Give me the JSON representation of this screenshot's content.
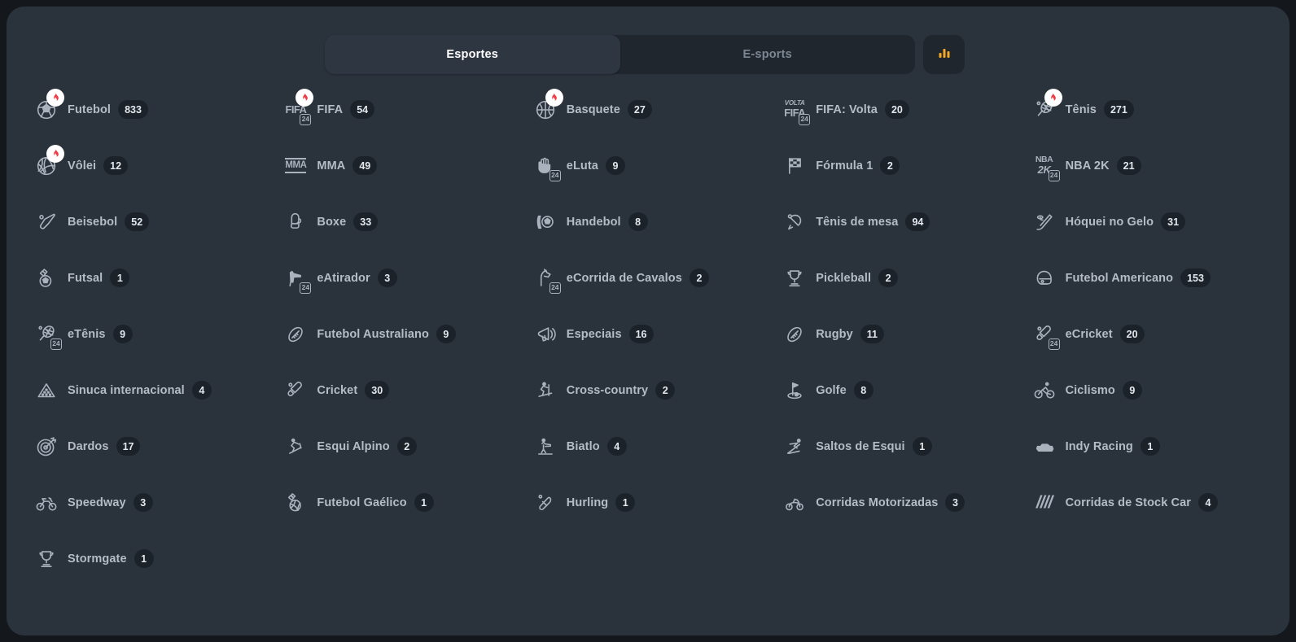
{
  "colors": {
    "page_background": "#14181d",
    "panel_background": "#2a323c",
    "tab_track": "#1f262e",
    "tab_active": "#2e3641",
    "accent_orange": "#f5a623",
    "hot_flame": "#ef3b45",
    "count_pill": "#1b222a",
    "label_text": "#b4bcc6"
  },
  "header": {
    "tabs": [
      {
        "label": "Esportes",
        "active": true,
        "name": "tab-esportes"
      },
      {
        "label": "E-sports",
        "active": false,
        "name": "tab-esports"
      }
    ],
    "chart_button": {
      "icon": "bar-chart-icon",
      "label": ""
    }
  },
  "grid": {
    "columns": 5,
    "items": [
      {
        "label": "Futebol",
        "count": "833",
        "icon": "soccer-ball-icon",
        "hot": true
      },
      {
        "label": "FIFA",
        "count": "54",
        "icon": "fifa-24-icon",
        "hot": true
      },
      {
        "label": "Basquete",
        "count": "27",
        "icon": "basketball-icon",
        "hot": true
      },
      {
        "label": "FIFA: Volta",
        "count": "20",
        "icon": "fifa-volta-24-icon",
        "hot": false
      },
      {
        "label": "Tênis",
        "count": "271",
        "icon": "tennis-racket-icon",
        "hot": true
      },
      {
        "label": "Vôlei",
        "count": "12",
        "icon": "volleyball-icon",
        "hot": true
      },
      {
        "label": "MMA",
        "count": "49",
        "icon": "mma-icon",
        "hot": false
      },
      {
        "label": "eLuta",
        "count": "9",
        "icon": "efighting-24-icon",
        "hot": false
      },
      {
        "label": "Fórmula 1",
        "count": "2",
        "icon": "checkered-flag-icon",
        "hot": false
      },
      {
        "label": "NBA 2K",
        "count": "21",
        "icon": "nba2k-24-icon",
        "hot": false
      },
      {
        "label": "Beisebol",
        "count": "52",
        "icon": "baseball-bat-icon",
        "hot": false
      },
      {
        "label": "Boxe",
        "count": "33",
        "icon": "boxing-glove-icon",
        "hot": false
      },
      {
        "label": "Handebol",
        "count": "8",
        "icon": "handball-icon",
        "hot": false
      },
      {
        "label": "Tênis de mesa",
        "count": "94",
        "icon": "table-tennis-icon",
        "hot": false
      },
      {
        "label": "Hóquei no Gelo",
        "count": "31",
        "icon": "ice-hockey-icon",
        "hot": false
      },
      {
        "label": "Futsal",
        "count": "1",
        "icon": "futsal-icon",
        "hot": false
      },
      {
        "label": "eAtirador",
        "count": "3",
        "icon": "eshooter-24-icon",
        "hot": false
      },
      {
        "label": "eCorrida de Cavalos",
        "count": "2",
        "icon": "ehorse-racing-24-icon",
        "hot": false
      },
      {
        "label": "Pickleball",
        "count": "2",
        "icon": "trophy-icon",
        "hot": false
      },
      {
        "label": "Futebol Americano",
        "count": "153",
        "icon": "football-helmet-icon",
        "hot": false
      },
      {
        "label": "eTênis",
        "count": "9",
        "icon": "etennis-24-icon",
        "hot": false
      },
      {
        "label": "Futebol Australiano",
        "count": "9",
        "icon": "aussie-rules-icon",
        "hot": false
      },
      {
        "label": "Especiais",
        "count": "16",
        "icon": "megaphone-icon",
        "hot": false
      },
      {
        "label": "Rugby",
        "count": "11",
        "icon": "rugby-ball-icon",
        "hot": false
      },
      {
        "label": "eCricket",
        "count": "20",
        "icon": "ecricket-24-icon",
        "hot": false
      },
      {
        "label": "Sinuca internacional",
        "count": "4",
        "icon": "snooker-rack-icon",
        "hot": false
      },
      {
        "label": "Cricket",
        "count": "30",
        "icon": "cricket-bat-icon",
        "hot": false
      },
      {
        "label": "Cross-country",
        "count": "2",
        "icon": "cross-country-icon",
        "hot": false
      },
      {
        "label": "Golfe",
        "count": "8",
        "icon": "golf-icon",
        "hot": false
      },
      {
        "label": "Ciclismo",
        "count": "9",
        "icon": "cycling-icon",
        "hot": false
      },
      {
        "label": "Dardos",
        "count": "17",
        "icon": "darts-icon",
        "hot": false
      },
      {
        "label": "Esqui Alpino",
        "count": "2",
        "icon": "alpine-skiing-icon",
        "hot": false
      },
      {
        "label": "Biatlo",
        "count": "4",
        "icon": "biathlon-icon",
        "hot": false
      },
      {
        "label": "Saltos de Esqui",
        "count": "1",
        "icon": "ski-jumping-icon",
        "hot": false
      },
      {
        "label": "Indy Racing",
        "count": "1",
        "icon": "indy-car-icon",
        "hot": false
      },
      {
        "label": "Speedway",
        "count": "3",
        "icon": "speedway-bike-icon",
        "hot": false
      },
      {
        "label": "Futebol Gaélico",
        "count": "1",
        "icon": "gaelic-football-icon",
        "hot": false
      },
      {
        "label": "Hurling",
        "count": "1",
        "icon": "hurling-stick-icon",
        "hot": false
      },
      {
        "label": "Corridas Motorizadas",
        "count": "3",
        "icon": "motor-racing-icon",
        "hot": false
      },
      {
        "label": "Corridas de Stock Car",
        "count": "4",
        "icon": "stock-car-icon",
        "hot": false
      },
      {
        "label": "Stormgate",
        "count": "1",
        "icon": "trophy-icon",
        "hot": false
      }
    ]
  }
}
